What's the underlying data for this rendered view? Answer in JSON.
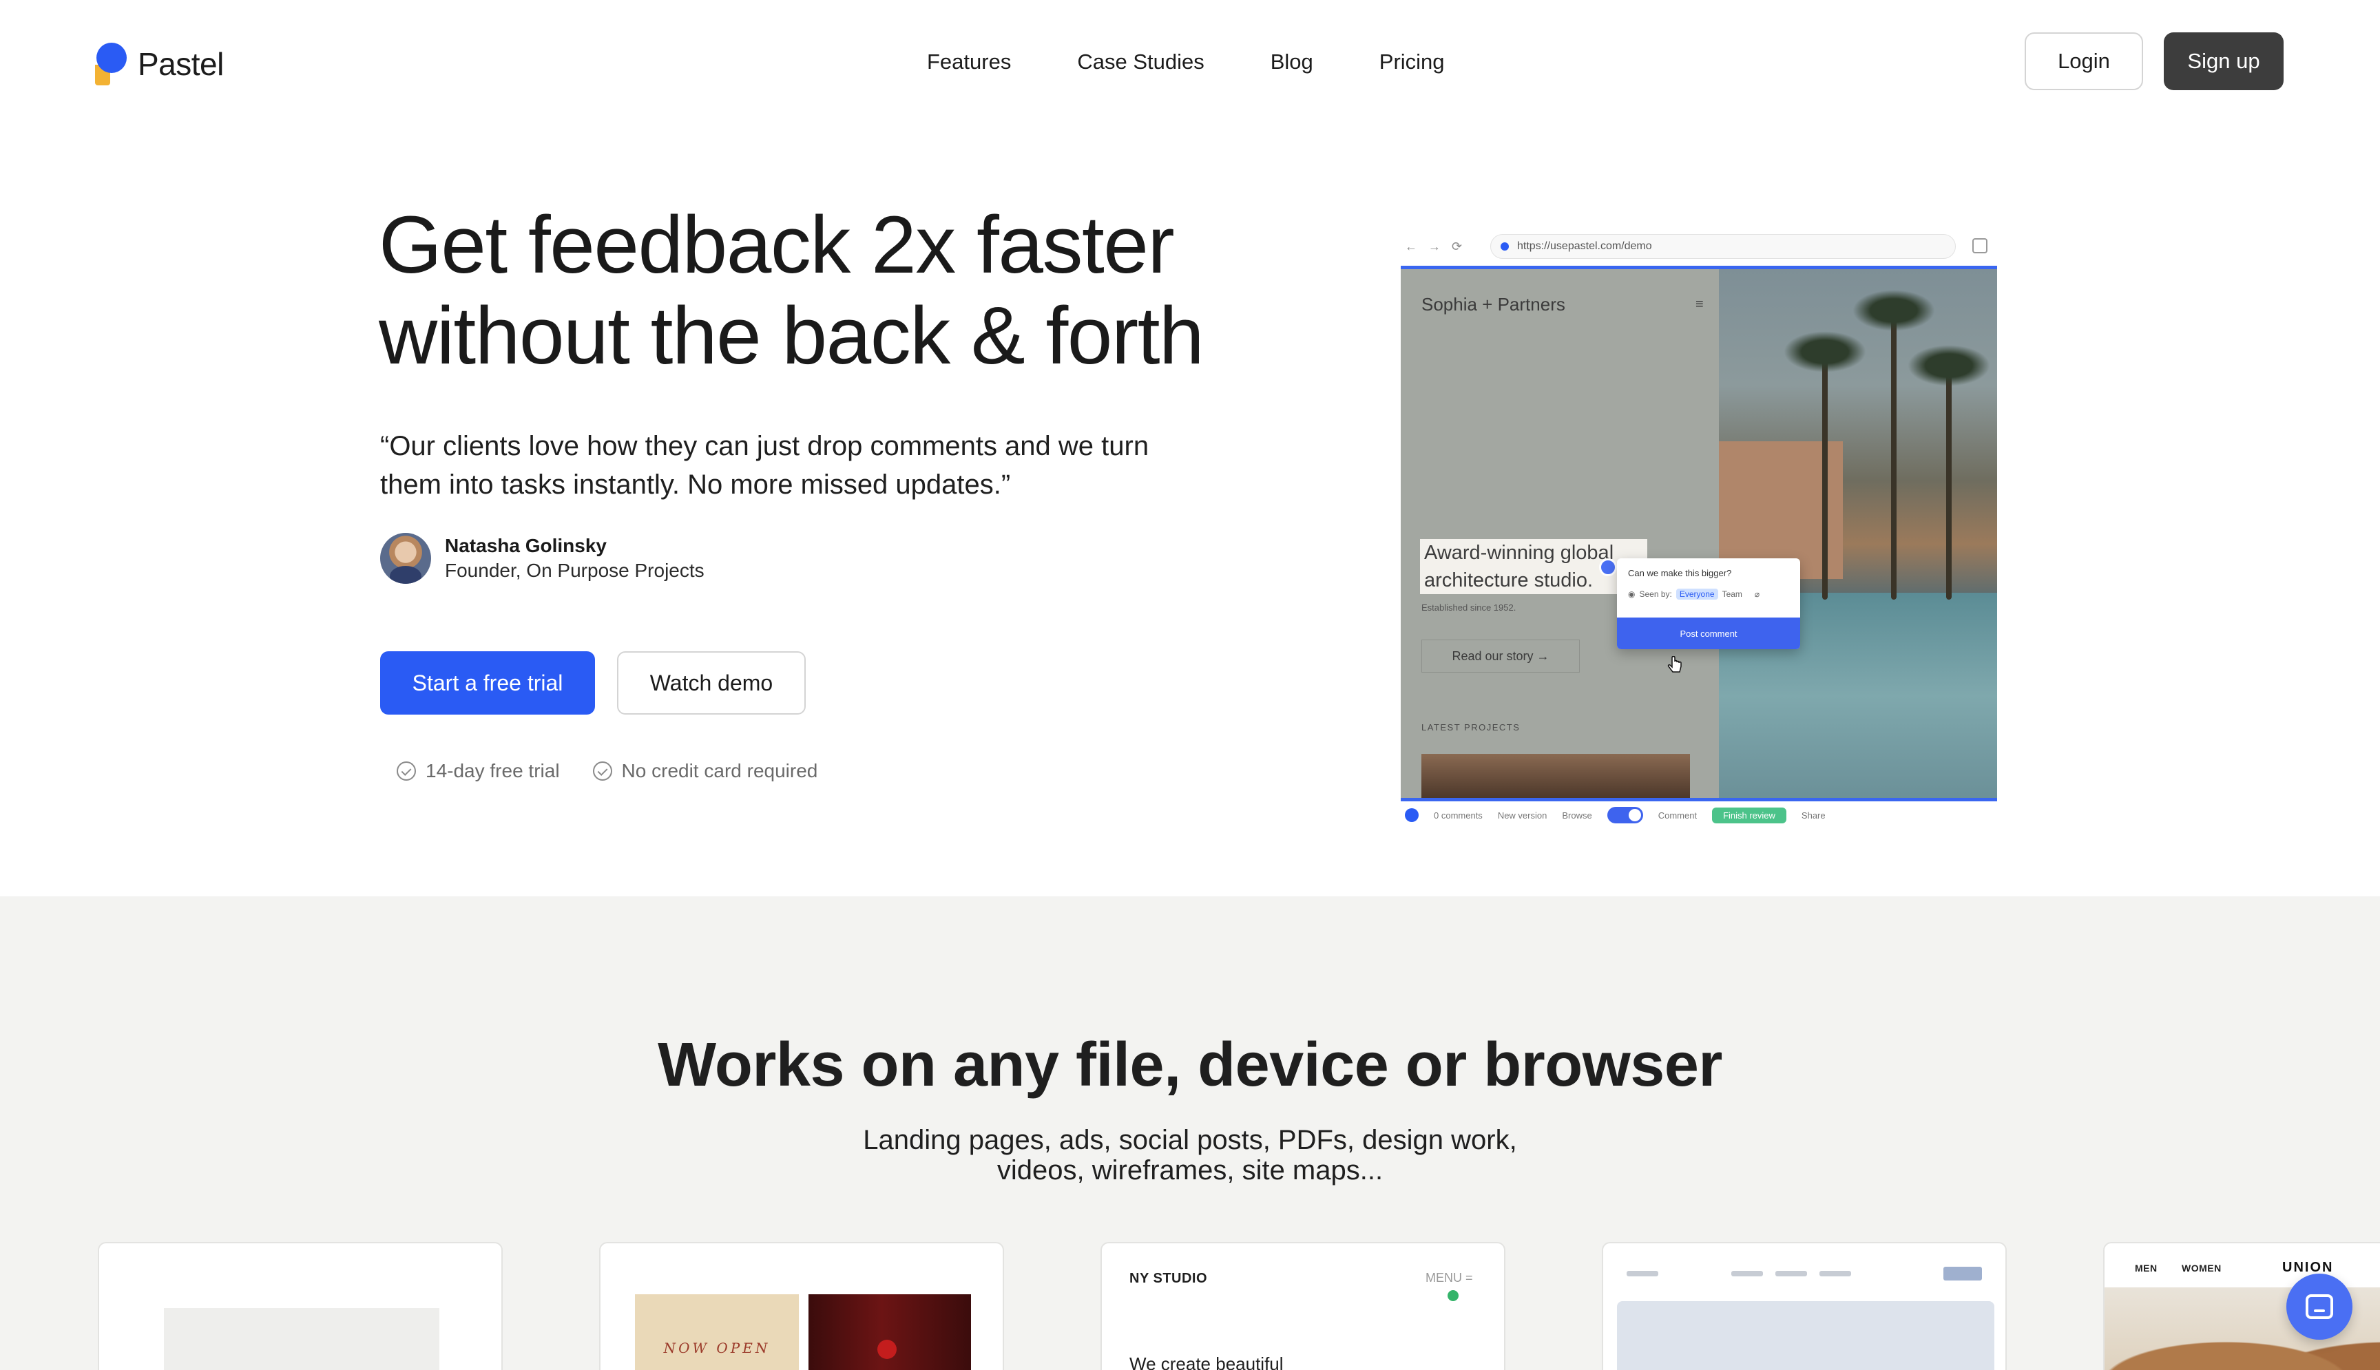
{
  "nav": {
    "brand": "Pastel",
    "links": [
      "Features",
      "Case Studies",
      "Blog",
      "Pricing"
    ],
    "login_label": "Login",
    "signup_label": "Sign up"
  },
  "hero": {
    "title_line1": "Get feedback 2x faster",
    "title_line2": "without the back & forth",
    "quote": "“Our clients love how they can just drop comments and we turn them into tasks instantly. No more missed updates.”",
    "author_name": "Natasha Golinsky",
    "author_role": "Founder, On Purpose Projects",
    "cta_primary": "Start a free trial",
    "cta_secondary": "Watch demo",
    "perks": [
      "14-day free trial",
      "No credit card required"
    ]
  },
  "mockup": {
    "url": "https://usepastel.com/demo",
    "site_brand": "Sophia + Partners",
    "headline": "Award-winning global architecture studio.",
    "since": "Established since 1952.",
    "story_button": "Read our story →",
    "latest_label": "LATEST PROJECTS",
    "comment_text": "Can we make this bigger?",
    "seen_by_label": "Seen by:",
    "seen_everyone": "Everyone",
    "seen_team": "Team",
    "post_comment": "Post comment",
    "toolbar": [
      "0 comments",
      "New version",
      "Browse",
      "Comment",
      "Finish review",
      "Share"
    ]
  },
  "section2": {
    "title": "Works on any file, device or browser",
    "subtitle_line1": "Landing pages, ads, social posts, PDFs, design work,",
    "subtitle_line2": "videos, wireframes, site maps..."
  },
  "cards": {
    "card2_text": "NOW OPEN",
    "card3_brand": "NY STUDIO",
    "card3_menu": "MENU",
    "card3_text": "We create beautiful",
    "card5_men": "MEN",
    "card5_women": "WOMEN",
    "card5_brand": "UNION"
  },
  "colors": {
    "accent": "#2a5bf4",
    "signup_bg": "#3d3d3d",
    "section_bg": "#f3f3f1",
    "logo_yellow": "#f3b233"
  }
}
